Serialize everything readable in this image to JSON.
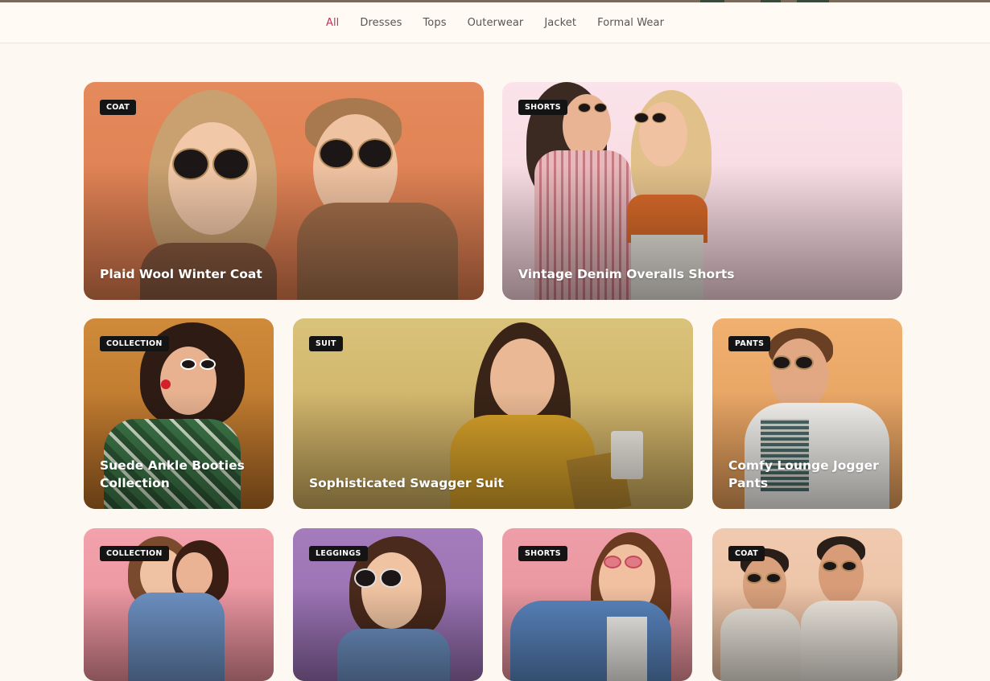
{
  "nav": {
    "items": [
      {
        "label": "All",
        "active": true
      },
      {
        "label": "Dresses",
        "active": false
      },
      {
        "label": "Tops",
        "active": false
      },
      {
        "label": "Outerwear",
        "active": false
      },
      {
        "label": "Jacket",
        "active": false
      },
      {
        "label": "Formal Wear",
        "active": false
      }
    ]
  },
  "cards": [
    {
      "badge": "COAT",
      "title": "Plaid Wool Winter Coat",
      "bg": "#e0845a"
    },
    {
      "badge": "SHORTS",
      "title": "Vintage Denim Overalls Shorts",
      "bg": "#f7d9e2"
    },
    {
      "badge": "COLLECTION",
      "title": "Suede Ankle Booties Collection",
      "bg": "#c47a2e"
    },
    {
      "badge": "SUIT",
      "title": "Sophisticated Swagger Suit",
      "bg": "#d4b86a"
    },
    {
      "badge": "PANTS",
      "title": "Comfy Lounge Jogger Pants",
      "bg": "#e8a766"
    },
    {
      "badge": "COLLECTION",
      "title": "",
      "bg": "#ee9aa6"
    },
    {
      "badge": "LEGGINGS",
      "title": "",
      "bg": "#a07ab8"
    },
    {
      "badge": "SHORTS",
      "title": "",
      "bg": "#ec9aa4"
    },
    {
      "badge": "COAT",
      "title": "",
      "bg": "#ecc6a8"
    }
  ]
}
